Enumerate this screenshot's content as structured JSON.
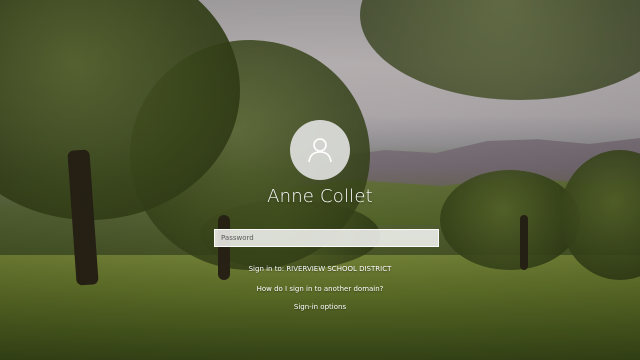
{
  "user": {
    "name": "Anne Collet",
    "avatar_icon": "user-icon"
  },
  "password_field": {
    "placeholder": "Password",
    "value": ""
  },
  "sign_in_to": "Sign in to: RIVERVIEW SCHOOL DISTRICT",
  "links": {
    "other_domain": "How do I sign in to another domain?",
    "sign_in_options": "Sign-in options"
  },
  "colors": {
    "text": "#ffffff",
    "field_background": "#ffffff"
  }
}
